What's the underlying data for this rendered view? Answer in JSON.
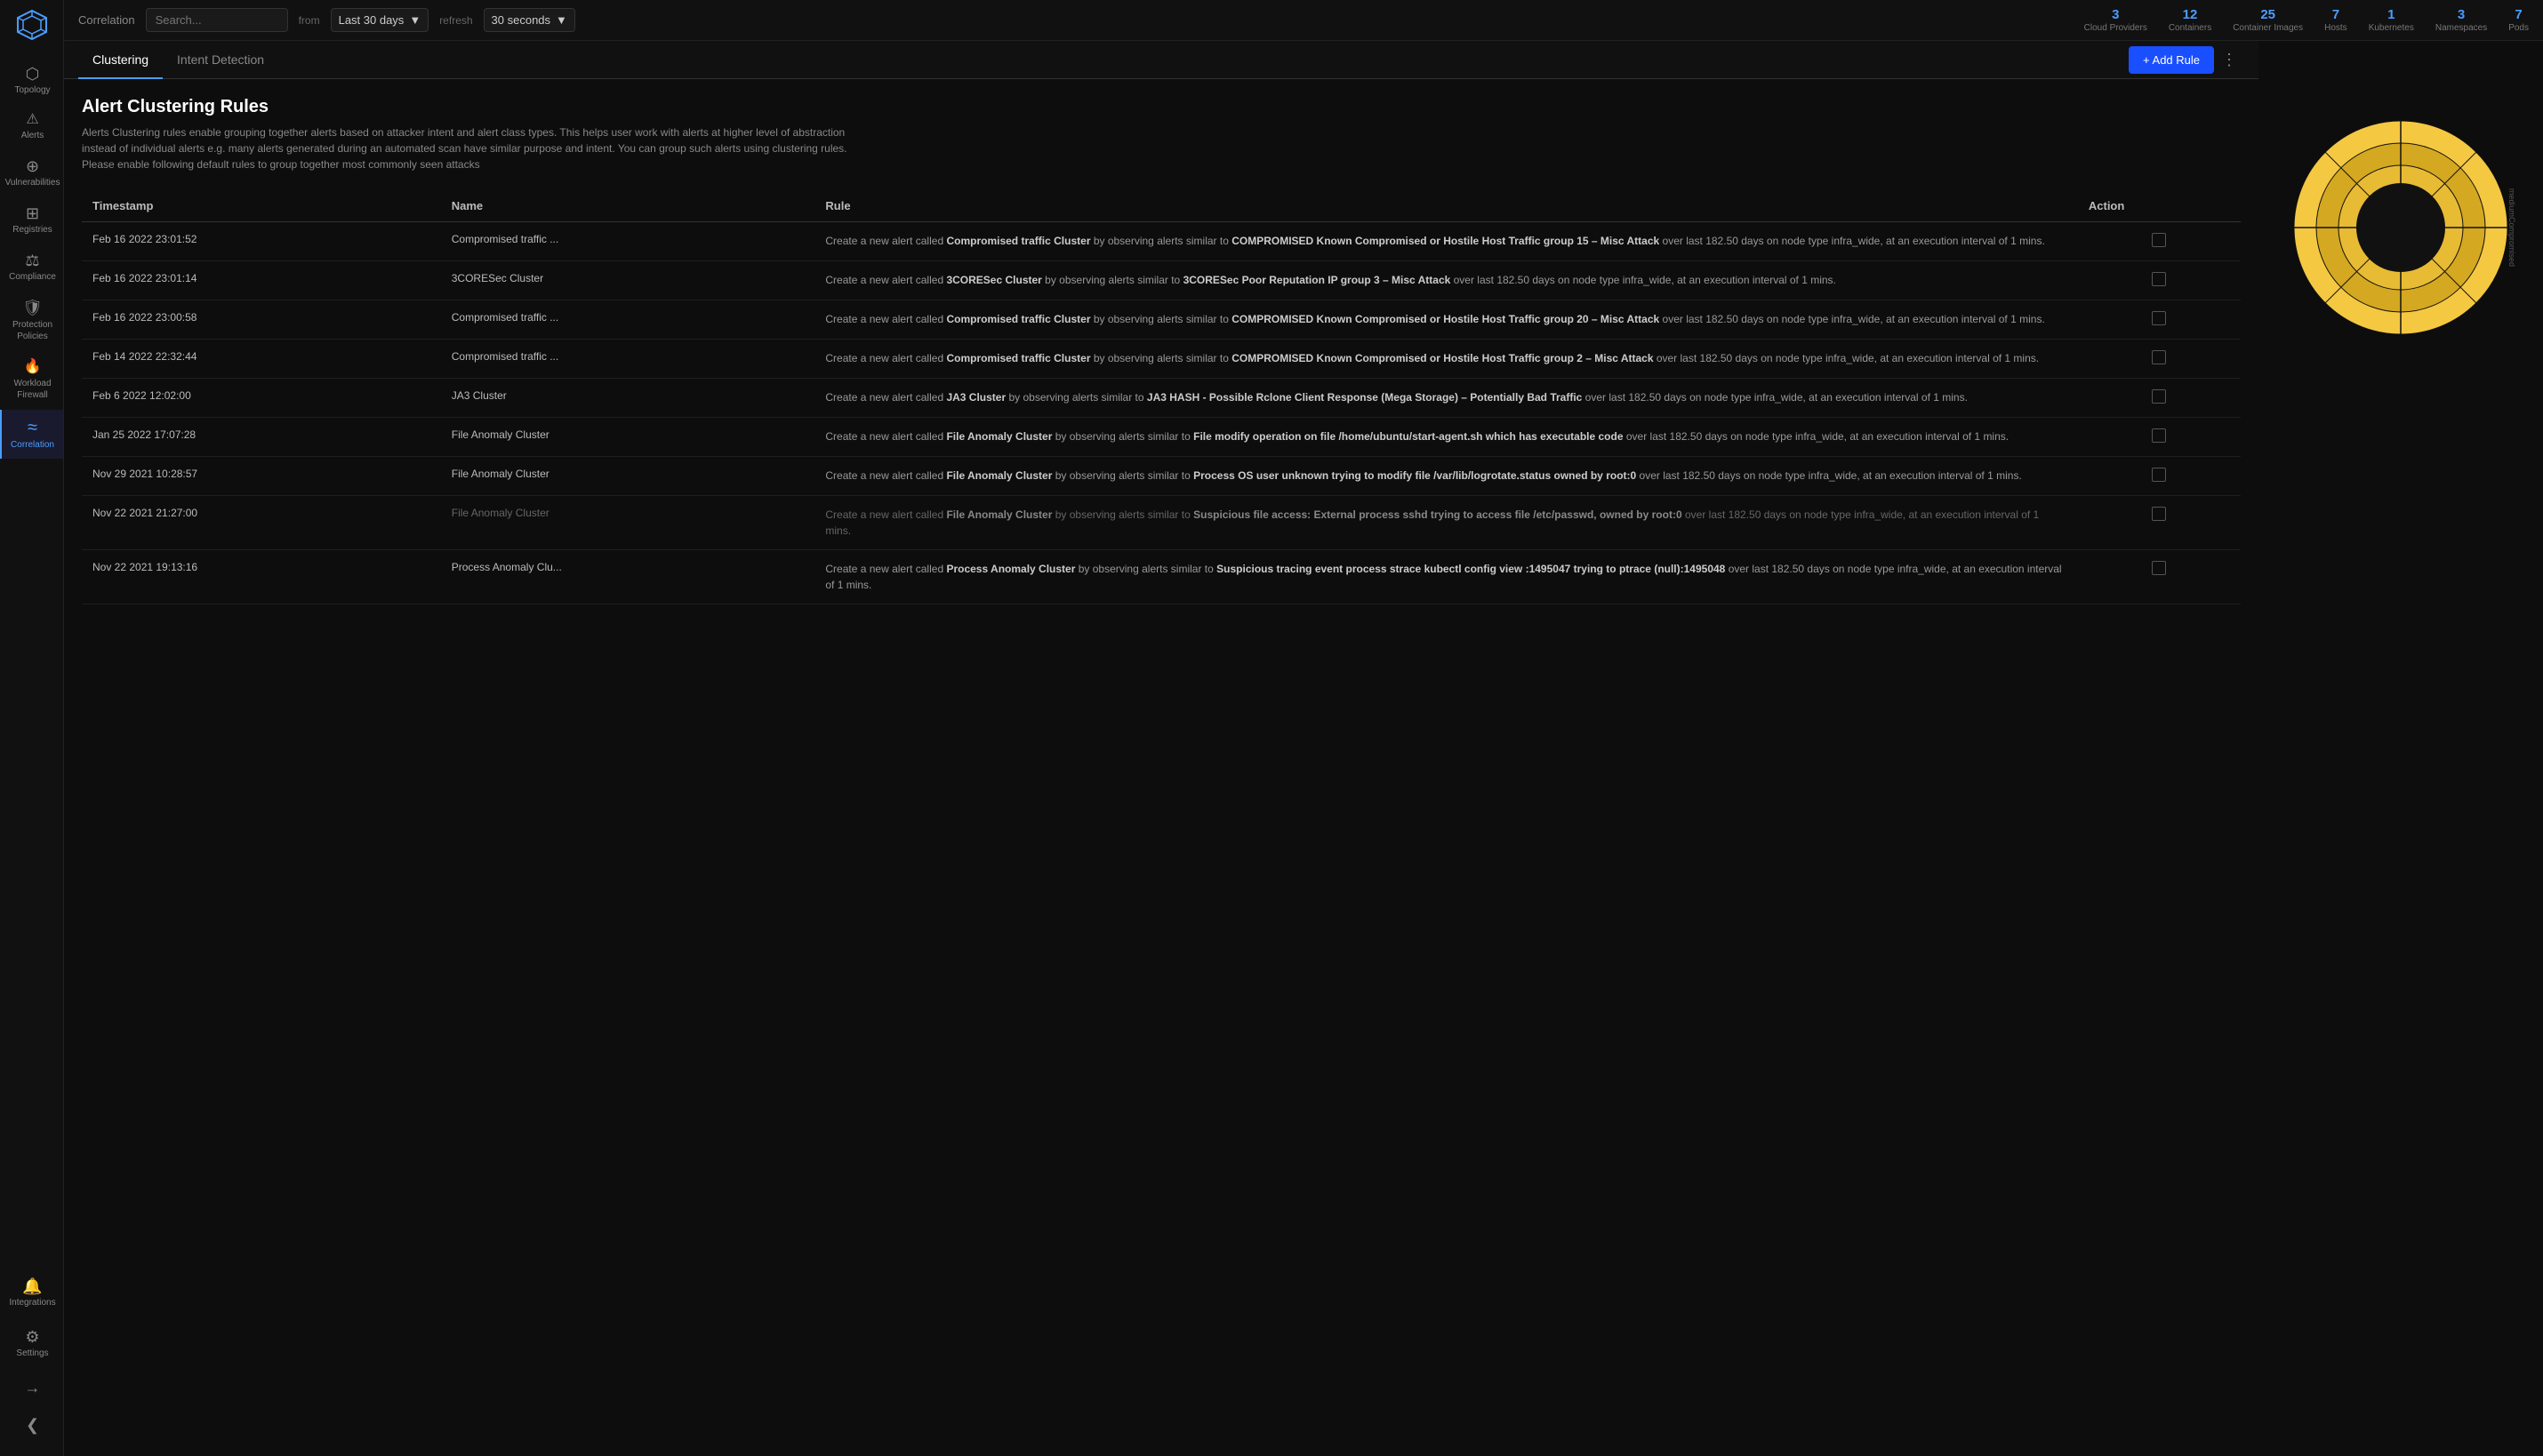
{
  "sidebar": {
    "logo": "▽",
    "items": [
      {
        "id": "topology",
        "label": "Topology",
        "icon": "⬡",
        "active": false
      },
      {
        "id": "alerts",
        "label": "Alerts",
        "icon": "🔔",
        "active": false
      },
      {
        "id": "vulnerabilities",
        "label": "Vulnerabilities",
        "icon": "⊕",
        "active": false
      },
      {
        "id": "registries",
        "label": "Registries",
        "icon": "⊞",
        "active": false
      },
      {
        "id": "compliance",
        "label": "Compliance",
        "icon": "⚖",
        "active": false
      },
      {
        "id": "protection-policies",
        "label": "Protection Policies",
        "icon": "🛡",
        "active": false
      },
      {
        "id": "workload-firewall",
        "label": "Workload Firewall",
        "icon": "🔥",
        "active": false
      },
      {
        "id": "correlation",
        "label": "Correlation",
        "icon": "≈",
        "active": true
      }
    ],
    "bottom_items": [
      {
        "id": "integrations",
        "label": "Integrations",
        "icon": "🔔"
      },
      {
        "id": "settings",
        "label": "Settings",
        "icon": "⚙"
      },
      {
        "id": "export",
        "label": "",
        "icon": "→"
      },
      {
        "id": "collapse",
        "label": "",
        "icon": "❮"
      }
    ]
  },
  "topbar": {
    "section_label": "Correlation",
    "search_placeholder": "Search...",
    "from_label": "from",
    "date_range": "Last 30 days",
    "refresh_label": "refresh",
    "refresh_interval": "30 seconds",
    "stats": [
      {
        "num": "3",
        "label": "Cloud Providers"
      },
      {
        "num": "12",
        "label": "Containers"
      },
      {
        "num": "25",
        "label": "Container Images"
      },
      {
        "num": "7",
        "label": "Hosts"
      },
      {
        "num": "1",
        "label": "Kubernetes"
      },
      {
        "num": "3",
        "label": "Namespaces"
      },
      {
        "num": "7",
        "label": "Pods"
      }
    ]
  },
  "tabs": [
    {
      "id": "clustering",
      "label": "Clustering",
      "active": true
    },
    {
      "id": "intent-detection",
      "label": "Intent Detection",
      "active": false
    }
  ],
  "add_rule_button": "+ Add Rule",
  "page": {
    "title": "Alert Clustering Rules",
    "description": "Alerts Clustering rules enable grouping together alerts based on attacker intent and alert class types. This helps user work with alerts at higher level of abstraction instead of individual alerts e.g. many alerts generated during an automated scan have similar purpose and intent. You can group such alerts using clustering rules. Please enable following default rules to group together most commonly seen attacks"
  },
  "table": {
    "columns": [
      "Timestamp",
      "Name",
      "Rule",
      "Action"
    ],
    "rows": [
      {
        "timestamp": "Feb 16 2022 23:01:52",
        "name": "Compromised traffic ...",
        "rule": "Create a new alert called {b}Compromised traffic Cluster{/b} by observing alerts similar to {b}COMPROMISED Known Compromised or Hostile Host Traffic group 15 – Misc Attack{/b} over last 182.50 days on node type infra_wide, at an execution interval of 1 mins.",
        "dimmed": false
      },
      {
        "timestamp": "Feb 16 2022 23:01:14",
        "name": "3CORESec Cluster",
        "rule": "Create a new alert called {b}3CORESec Cluster{/b} by observing alerts similar to {b}3CORESec Poor Reputation IP group 3 – Misc Attack{/b} over last 182.50 days on node type infra_wide, at an execution interval of 1 mins.",
        "dimmed": false
      },
      {
        "timestamp": "Feb 16 2022 23:00:58",
        "name": "Compromised traffic ...",
        "rule": "Create a new alert called {b}Compromised traffic Cluster{/b} by observing alerts similar to {b}COMPROMISED Known Compromised or Hostile Host Traffic group 20 – Misc Attack{/b} over last 182.50 days on node type infra_wide, at an execution interval of 1 mins.",
        "dimmed": false
      },
      {
        "timestamp": "Feb 14 2022 22:32:44",
        "name": "Compromised traffic ...",
        "rule": "Create a new alert called {b}Compromised traffic Cluster{/b} by observing alerts similar to {b}COMPROMISED Known Compromised or Hostile Host Traffic group 2 – Misc Attack{/b} over last 182.50 days on node type infra_wide, at an execution interval of 1 mins.",
        "dimmed": false
      },
      {
        "timestamp": "Feb 6 2022 12:02:00",
        "name": "JA3 Cluster",
        "rule": "Create a new alert called {b}JA3 Cluster{/b} by observing alerts similar to {b}JA3 HASH - Possible Rclone Client Response (Mega Storage) – Potentially Bad Traffic{/b} over last 182.50 days on node type infra_wide, at an execution interval of 1 mins.",
        "dimmed": false
      },
      {
        "timestamp": "Jan 25 2022 17:07:28",
        "name": "File Anomaly Cluster",
        "rule": "Create a new alert called {b}File Anomaly Cluster{/b} by observing alerts similar to {b}File modify operation on file /home/ubuntu/start-agent.sh which has executable code{/b} over last 182.50 days on node type infra_wide, at an execution interval of 1 mins.",
        "dimmed": false
      },
      {
        "timestamp": "Nov 29 2021 10:28:57",
        "name": "File Anomaly Cluster",
        "rule": "Create a new alert called {b}File Anomaly Cluster{/b} by observing alerts similar to {b}Process OS user unknown trying to modify file /var/lib/logrotate.status owned by root:0{/b} over last 182.50 days on node type infra_wide, at an execution interval of 1 mins.",
        "dimmed": false
      },
      {
        "timestamp": "Nov 22 2021 21:27:00",
        "name": "File Anomaly Cluster",
        "rule": "Create a new alert called {b}File Anomaly Cluster{/b} by observing alerts similar to {b}Suspicious file access: External process sshd trying to access file /etc/passwd, owned by root:0{/b} over last 182.50 days on node type infra_wide, at an execution interval of 1 mins.",
        "dimmed": true
      },
      {
        "timestamp": "Nov 22 2021 19:13:16",
        "name": "Process Anomaly Clu...",
        "rule": "Create a new alert called {b}Process Anomaly Cluster{/b} by observing alerts similar to {b}Suspicious tracing event process strace kubectl config view :1495047 trying to ptrace (null):1495048{/b} over last 182.50 days on node type infra_wide, at an execution interval of 1 mins.",
        "dimmed": false
      }
    ]
  },
  "chart": {
    "label": "mediumCompromised",
    "outer_color": "#f5c842",
    "inner_color": "#d4a820",
    "center_color": "#111"
  }
}
